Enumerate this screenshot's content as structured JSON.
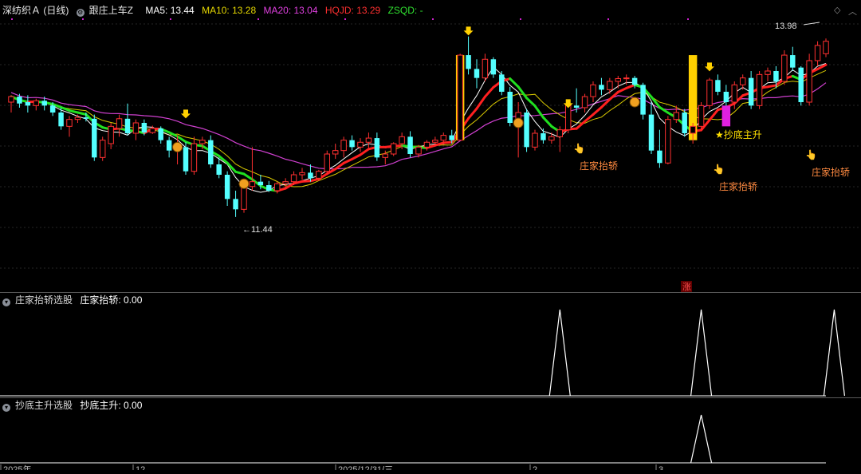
{
  "header": {
    "stock": "深纺织Ａ (日线)",
    "indicator": "跟庄上车Z",
    "ma5": "MA5: 13.44",
    "ma10": "MA10: 13.28",
    "ma20": "MA20: 13.04",
    "hqjd": "HQJD: 13.29",
    "zsqd": "ZSQD: -"
  },
  "panel1": {
    "title": "庄家抬轿选股",
    "value": "庄家抬轿: 0.00"
  },
  "panel2": {
    "title": "抄底主升选股",
    "value": "抄底主升: 0.00"
  },
  "labels": {
    "high": "13.98",
    "low": "←11.44",
    "zhuang": "庄家抬轿",
    "chaodi": "★抄底主升",
    "zhang": "涨"
  },
  "axis_dates": [
    "2025年",
    "12",
    "2025/12/31/三",
    "2",
    "3"
  ],
  "colors": {
    "up": "#ff3030",
    "down": "#54ffff",
    "ma5": "#ffffff",
    "ma10": "#d8c800",
    "ma20": "#d040d0",
    "hqjd_up": "#ff2020",
    "hqjd_down": "#20e020",
    "signal": "#ffd000",
    "grid": "#333"
  },
  "chart_data": {
    "type": "candlestick",
    "price_range": [
      10.4,
      14.3
    ],
    "bars": [
      [
        13.1,
        13.2,
        12.95,
        13.18
      ],
      [
        13.18,
        13.22,
        13.02,
        13.08
      ],
      [
        13.1,
        13.2,
        12.95,
        13.05
      ],
      [
        13.05,
        13.15,
        12.98,
        13.12
      ],
      [
        13.12,
        13.18,
        12.98,
        13.05
      ],
      [
        13.05,
        13.1,
        12.9,
        12.95
      ],
      [
        12.95,
        13.02,
        12.7,
        12.75
      ],
      [
        12.75,
        12.9,
        12.6,
        12.85
      ],
      [
        12.85,
        12.92,
        12.8,
        12.88
      ],
      [
        12.88,
        12.95,
        12.82,
        12.86
      ],
      [
        12.86,
        12.92,
        12.25,
        12.3
      ],
      [
        12.3,
        12.6,
        12.25,
        12.55
      ],
      [
        12.5,
        12.8,
        12.42,
        12.75
      ],
      [
        12.72,
        12.92,
        12.6,
        12.86
      ],
      [
        12.86,
        13.08,
        12.62,
        12.65
      ],
      [
        12.65,
        12.85,
        12.55,
        12.8
      ],
      [
        12.8,
        12.85,
        12.62,
        12.66
      ],
      [
        12.66,
        12.76,
        12.64,
        12.72
      ],
      [
        12.72,
        12.75,
        12.5,
        12.55
      ],
      [
        12.55,
        12.6,
        12.3,
        12.4
      ],
      [
        12.4,
        12.62,
        12.2,
        12.45
      ],
      [
        12.45,
        12.52,
        12.05,
        12.1
      ],
      [
        12.1,
        12.6,
        12.05,
        12.5
      ],
      [
        12.5,
        12.6,
        12.42,
        12.55
      ],
      [
        12.55,
        12.62,
        12.15,
        12.2
      ],
      [
        12.2,
        12.3,
        12.0,
        12.05
      ],
      [
        12.05,
        12.1,
        11.6,
        11.7
      ],
      [
        11.7,
        11.82,
        11.44,
        11.55
      ],
      [
        11.55,
        11.9,
        11.5,
        11.88
      ],
      [
        11.88,
        12.45,
        11.82,
        11.95
      ],
      [
        11.95,
        12.05,
        11.84,
        11.9
      ],
      [
        11.9,
        11.96,
        11.8,
        11.82
      ],
      [
        11.82,
        11.95,
        11.78,
        11.92
      ],
      [
        11.92,
        12.0,
        11.85,
        11.95
      ],
      [
        11.95,
        12.1,
        11.9,
        12.05
      ],
      [
        12.05,
        12.15,
        11.98,
        12.08
      ],
      [
        12.08,
        12.2,
        11.95,
        12.0
      ],
      [
        12.0,
        12.12,
        11.96,
        12.1
      ],
      [
        12.1,
        12.4,
        12.05,
        12.35
      ],
      [
        12.35,
        12.5,
        12.28,
        12.4
      ],
      [
        12.4,
        12.6,
        12.3,
        12.55
      ],
      [
        12.55,
        12.62,
        12.4,
        12.45
      ],
      [
        12.45,
        12.58,
        12.38,
        12.52
      ],
      [
        12.52,
        12.66,
        12.44,
        12.58
      ],
      [
        12.58,
        12.66,
        12.25,
        12.3
      ],
      [
        12.3,
        12.4,
        12.2,
        12.35
      ],
      [
        12.35,
        12.52,
        12.32,
        12.5
      ],
      [
        12.5,
        12.66,
        12.42,
        12.6
      ],
      [
        12.6,
        12.68,
        12.3,
        12.35
      ],
      [
        12.35,
        12.48,
        12.3,
        12.45
      ],
      [
        12.45,
        12.55,
        12.4,
        12.52
      ],
      [
        12.52,
        12.6,
        12.46,
        12.55
      ],
      [
        12.55,
        12.66,
        12.48,
        12.62
      ],
      [
        12.62,
        12.7,
        12.5,
        12.55
      ],
      [
        12.55,
        13.8,
        12.55,
        13.78
      ],
      [
        13.78,
        14.05,
        13.5,
        13.58
      ],
      [
        13.58,
        13.72,
        13.3,
        13.45
      ],
      [
        13.45,
        13.8,
        13.4,
        13.72
      ],
      [
        13.72,
        13.75,
        13.45,
        13.5
      ],
      [
        13.5,
        13.55,
        13.2,
        13.25
      ],
      [
        13.25,
        13.32,
        12.75,
        12.8
      ],
      [
        12.8,
        13.1,
        12.3,
        12.95
      ],
      [
        12.95,
        13.0,
        12.38,
        12.45
      ],
      [
        12.45,
        12.7,
        12.4,
        12.65
      ],
      [
        12.65,
        12.72,
        12.5,
        12.55
      ],
      [
        12.55,
        12.66,
        12.5,
        12.6
      ],
      [
        12.6,
        12.75,
        12.38,
        12.7
      ],
      [
        12.7,
        13.1,
        12.65,
        13.05
      ],
      [
        13.05,
        13.3,
        12.95,
        13.02
      ],
      [
        13.02,
        13.22,
        12.95,
        13.18
      ],
      [
        13.18,
        13.4,
        13.1,
        13.35
      ],
      [
        13.35,
        13.45,
        13.2,
        13.28
      ],
      [
        13.28,
        13.45,
        13.22,
        13.4
      ],
      [
        13.4,
        13.48,
        13.3,
        13.44
      ],
      [
        13.44,
        13.5,
        13.35,
        13.45
      ],
      [
        13.45,
        13.48,
        13.3,
        13.35
      ],
      [
        13.35,
        13.38,
        12.85,
        12.92
      ],
      [
        12.92,
        13.1,
        12.35,
        12.4
      ],
      [
        12.4,
        12.7,
        12.15,
        12.22
      ],
      [
        12.22,
        12.9,
        12.2,
        12.85
      ],
      [
        12.85,
        13.05,
        12.8,
        12.95
      ],
      [
        12.95,
        13.0,
        12.6,
        12.65
      ],
      [
        12.65,
        12.8,
        12.5,
        12.75
      ],
      [
        12.75,
        13.1,
        12.7,
        13.05
      ],
      [
        13.05,
        13.45,
        13.0,
        13.42
      ],
      [
        13.42,
        13.5,
        13.2,
        13.25
      ],
      [
        13.25,
        13.35,
        13.05,
        13.1
      ],
      [
        13.1,
        13.4,
        13.0,
        13.35
      ],
      [
        13.35,
        13.5,
        13.28,
        13.45
      ],
      [
        13.45,
        13.55,
        13.0,
        13.05
      ],
      [
        13.05,
        13.55,
        13.0,
        13.5
      ],
      [
        13.5,
        13.6,
        13.4,
        13.55
      ],
      [
        13.55,
        13.62,
        13.3,
        13.4
      ],
      [
        13.4,
        13.85,
        13.35,
        13.78
      ],
      [
        13.78,
        13.9,
        13.55,
        13.6
      ],
      [
        13.6,
        13.62,
        13.05,
        13.1
      ],
      [
        13.1,
        13.8,
        13.05,
        13.7
      ],
      [
        13.7,
        13.98,
        13.62,
        13.92
      ],
      [
        13.8,
        14.02,
        13.75,
        13.98
      ]
    ],
    "signals": {
      "zhuang_tai_jiao": [
        66,
        83,
        99
      ],
      "chao_di_zhu_sheng": [
        83
      ]
    }
  }
}
